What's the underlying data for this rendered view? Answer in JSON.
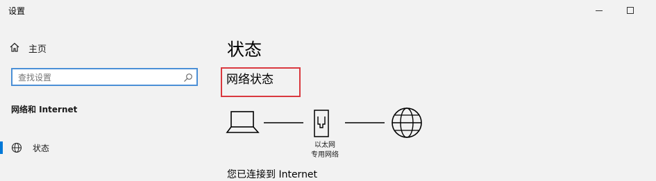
{
  "window": {
    "title": "设置"
  },
  "sidebar": {
    "home_label": "主页",
    "search": {
      "placeholder": "查找设置",
      "value": ""
    },
    "section_title": "网络和 Internet",
    "items": [
      {
        "label": "状态",
        "selected": true,
        "icon": "status-globe-icon"
      }
    ]
  },
  "main": {
    "title": "状态",
    "section_heading": "网络状态",
    "diagram": {
      "icons": [
        "laptop-icon",
        "ethernet-adapter-icon",
        "globe-icon"
      ],
      "adapter_label_line1": "以太网",
      "adapter_label_line2": "专用网络"
    },
    "partial_line": "您已连接到 Internet"
  },
  "colors": {
    "accent": "#0078d7",
    "highlight": "#d9383e",
    "search_border": "#4a8fd6"
  }
}
